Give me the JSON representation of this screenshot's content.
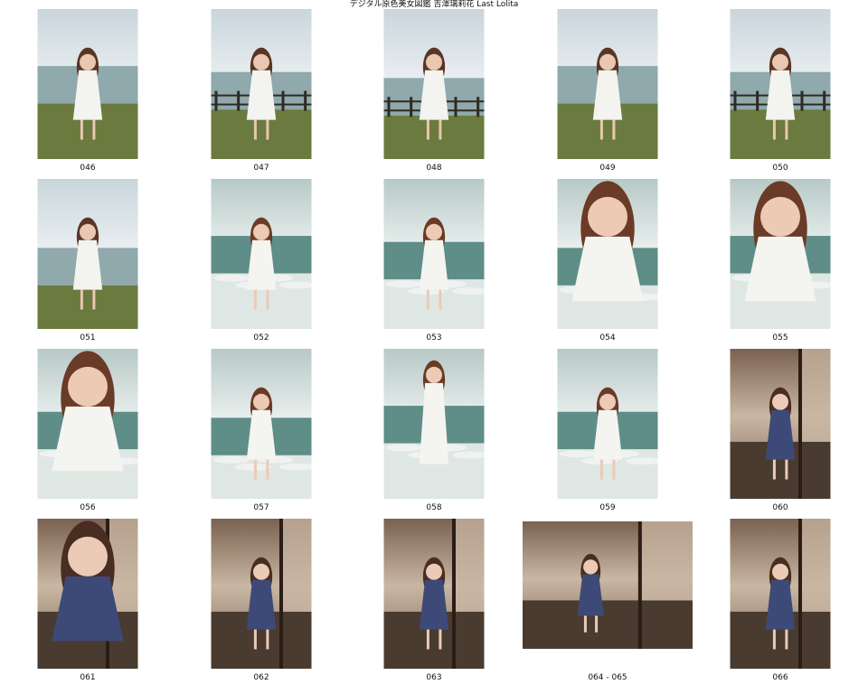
{
  "title": "デジタル原色美女図鑑 吉澤璃莉花 Last Lolita",
  "thumbnails": [
    {
      "label": "046",
      "scene": "beach-grass",
      "wide": false
    },
    {
      "label": "047",
      "scene": "beach-fence-far",
      "wide": false
    },
    {
      "label": "048",
      "scene": "beach-fence-mid",
      "wide": false
    },
    {
      "label": "049",
      "scene": "beach-grass-profile",
      "wide": false
    },
    {
      "label": "050",
      "scene": "beach-railing",
      "wide": false
    },
    {
      "label": "051",
      "scene": "beach-path",
      "wide": false
    },
    {
      "label": "052",
      "scene": "sea-splash",
      "wide": false
    },
    {
      "label": "053",
      "scene": "sea-shore",
      "wide": false
    },
    {
      "label": "054",
      "scene": "sea-closeup",
      "wide": false
    },
    {
      "label": "055",
      "scene": "sea-portrait",
      "wide": false
    },
    {
      "label": "056",
      "scene": "sea-portrait-smile",
      "wide": false
    },
    {
      "label": "057",
      "scene": "sea-walk",
      "wide": false
    },
    {
      "label": "058",
      "scene": "sea-hands-head",
      "wide": false
    },
    {
      "label": "059",
      "scene": "sea-arm-up",
      "wide": false
    },
    {
      "label": "060",
      "scene": "room-window",
      "wide": false
    },
    {
      "label": "061",
      "scene": "room-portrait",
      "wide": false
    },
    {
      "label": "062",
      "scene": "room-tatami",
      "wide": false
    },
    {
      "label": "063",
      "scene": "room-floor",
      "wide": false
    },
    {
      "label": "064 - 065",
      "scene": "room-sitting-wide",
      "wide": true
    },
    {
      "label": "066",
      "scene": "room-standing",
      "wide": false
    }
  ]
}
